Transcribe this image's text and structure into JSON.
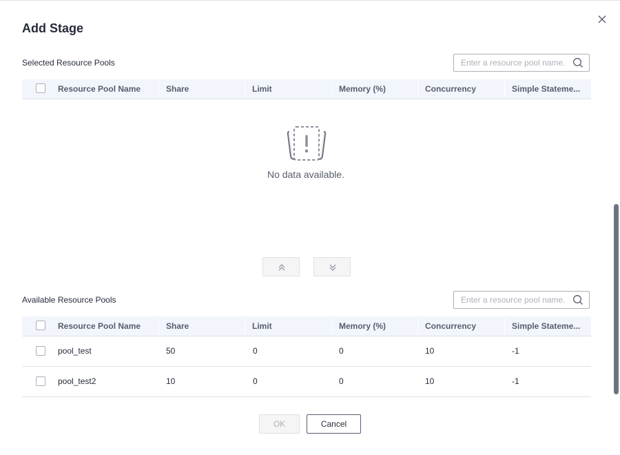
{
  "dialog": {
    "title": "Add Stage",
    "ok_label": "OK",
    "cancel_label": "Cancel",
    "close_icon": "close-icon"
  },
  "selected": {
    "label": "Selected Resource Pools",
    "search_placeholder": "Enter a resource pool name.",
    "columns": [
      "Resource Pool Name",
      "Share",
      "Limit",
      "Memory (%)",
      "Concurrency",
      "Simple Stateme..."
    ],
    "empty_text": "No data available.",
    "empty_icon": "no-data-icon"
  },
  "transfer": {
    "up_icon": "double-chevron-up-icon",
    "down_icon": "double-chevron-down-icon"
  },
  "available": {
    "label": "Available Resource Pools",
    "search_placeholder": "Enter a resource pool name.",
    "columns": [
      "Resource Pool Name",
      "Share",
      "Limit",
      "Memory (%)",
      "Concurrency",
      "Simple Stateme..."
    ],
    "rows": [
      [
        "pool_test",
        "50",
        "0",
        "0",
        "10",
        "-1"
      ],
      [
        "pool_test2",
        "10",
        "0",
        "0",
        "10",
        "-1"
      ]
    ]
  },
  "colors": {
    "header_bg": "#f2f5fc",
    "border": "#dfe1e6",
    "text": "#252b3a",
    "muted": "#adb0b8"
  }
}
